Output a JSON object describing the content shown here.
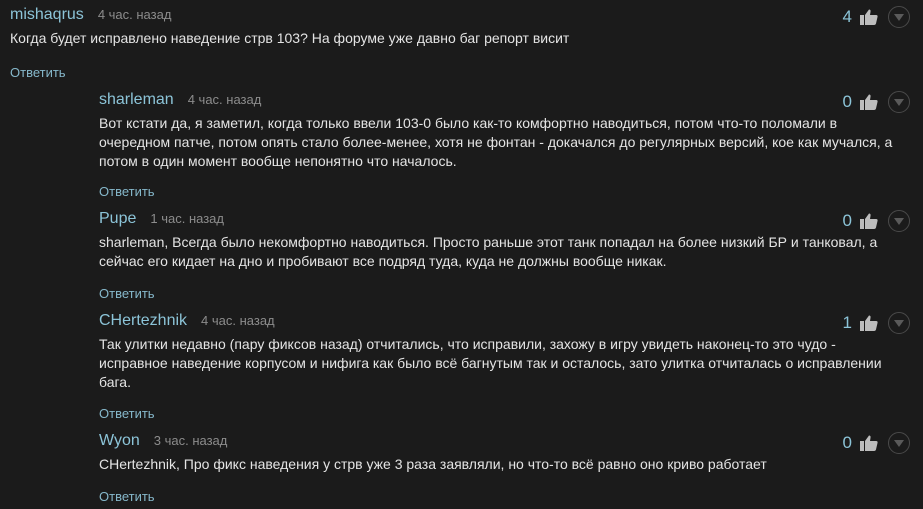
{
  "reply_label": "Ответить",
  "comments": [
    {
      "author": "mishaqrus",
      "time": "4 час. назад",
      "votes": "4",
      "lines": [
        "Когда будет исправлено наведение стрв 103? На форуме уже давно баг репорт висит"
      ]
    },
    {
      "author": "sharleman",
      "time": "4 час. назад",
      "votes": "0",
      "lines": [
        "Вот кстати да, я заметил, когда только ввели 103-0 было как-то комфортно наводиться, потом что-то поломали в",
        "очередном патче, потом опять стало более-менее, хотя не фонтан - докачался до регулярных версий, кое как мучался, а",
        "потом в один момент вообще непонятно что началось."
      ]
    },
    {
      "author": "Pupe",
      "time": "1 час. назад",
      "votes": "0",
      "lines": [
        "sharleman, Всегда было некомфортно наводиться. Просто раньше этот танк попадал на более низкий БР и танковал, а",
        "сейчас его кидает на дно и пробивают все подряд туда, куда не должны вообще никак."
      ]
    },
    {
      "author": "CHertezhnik",
      "time": "4 час. назад",
      "votes": "1",
      "lines": [
        "Так улитки недавно (пару фиксов назад) отчитались, что исправили, захожу в игру увидеть наконец-то это чудо -",
        "исправное наведение корпусом и нифига как было всё багнутым так и осталось, зато улитка отчиталась о исправлении",
        "бага."
      ]
    },
    {
      "author": "Wyon",
      "time": "3 час. назад",
      "votes": "0",
      "lines": [
        "CHertezhnik, Про фикс наведения у стрв уже 3 раза заявляли, но что-то всё равно оно криво работает"
      ]
    }
  ]
}
